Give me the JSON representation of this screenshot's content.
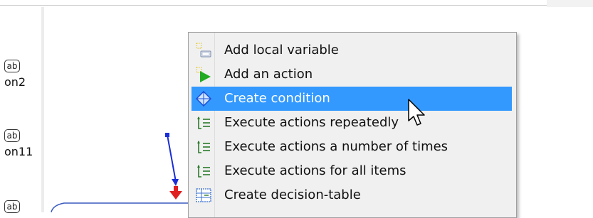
{
  "palette": {
    "items": [
      {
        "icon_text": "ab",
        "label": "on2"
      },
      {
        "icon_text": "ab",
        "label": "on11"
      },
      {
        "icon_text": "ab",
        "label": ""
      }
    ]
  },
  "context_menu": {
    "items": [
      {
        "label": "Add local variable",
        "icon": "add-local-variable-icon"
      },
      {
        "label": "Add an action",
        "icon": "add-action-icon"
      },
      {
        "label": "Create condition",
        "icon": "create-condition-icon",
        "selected": true
      },
      {
        "label": "Execute actions repeatedly",
        "icon": "loop-icon"
      },
      {
        "label": "Execute actions a number of times",
        "icon": "loop-icon"
      },
      {
        "label": "Execute actions for all items",
        "icon": "loop-icon"
      },
      {
        "label": "Create decision-table",
        "icon": "decision-table-icon"
      }
    ]
  },
  "colors": {
    "selection": "#3399ff",
    "connector": "#1a2ed6",
    "arrow": "#e02020",
    "action_green": "#22aa22"
  }
}
